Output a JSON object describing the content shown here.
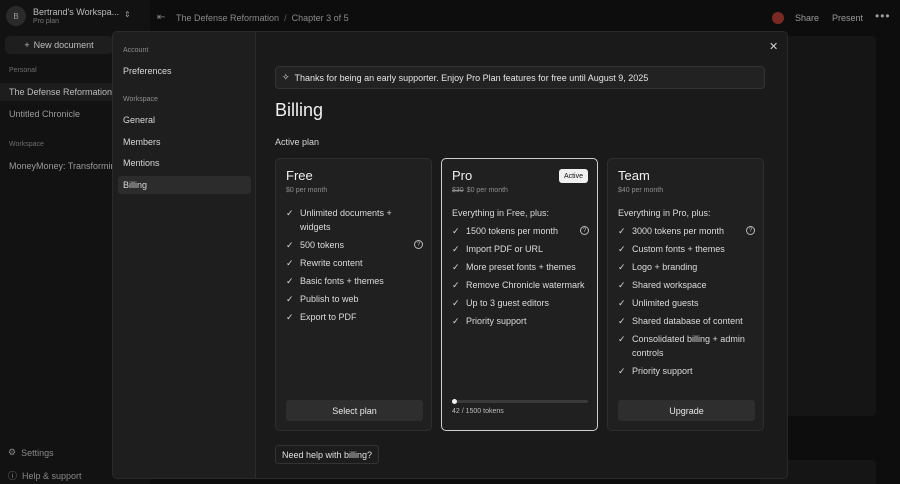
{
  "workspace": {
    "initial": "B",
    "name": "Bertrand's Workspa...",
    "plan": "Pro plan"
  },
  "sidebar": {
    "new_document": "New document",
    "personal_label": "Personal",
    "personal_items": [
      "The Defense Reformation",
      "Untitled Chronicle"
    ],
    "workspace_label": "Workspace",
    "workspace_items": [
      "MoneyMoney: Transforming"
    ],
    "settings": "Settings",
    "help": "Help & support"
  },
  "topbar": {
    "breadcrumb": [
      "The Defense Reformation",
      "Chapter 3 of 5"
    ],
    "separator": "/",
    "share": "Share",
    "present": "Present"
  },
  "modal": {
    "nav": {
      "account_label": "Account",
      "account_items": [
        "Preferences"
      ],
      "workspace_label": "Workspace",
      "workspace_items": [
        "General",
        "Members",
        "Mentions",
        "Billing"
      ],
      "active": "Billing"
    },
    "banner": "Thanks for being an early supporter. Enjoy Pro Plan features for free until August 9, 2025",
    "title": "Billing",
    "active_plan_label": "Active plan",
    "plans": [
      {
        "name": "Free",
        "price": "$0 per month",
        "old_price": "",
        "intro": "",
        "features": [
          {
            "text": "Unlimited documents + widgets",
            "help": false
          },
          {
            "text": "500 tokens",
            "help": true
          },
          {
            "text": "Rewrite content",
            "help": false
          },
          {
            "text": "Basic fonts + themes",
            "help": false
          },
          {
            "text": "Publish to web",
            "help": false
          },
          {
            "text": "Export to PDF",
            "help": false
          }
        ],
        "button": "Select plan"
      },
      {
        "name": "Pro",
        "price": "$0 per month",
        "old_price": "$30",
        "badge": "Active",
        "intro": "Everything in Free, plus:",
        "features": [
          {
            "text": "1500 tokens per month",
            "help": true
          },
          {
            "text": "Import PDF or URL",
            "help": false
          },
          {
            "text": "More preset fonts + themes",
            "help": false
          },
          {
            "text": "Remove Chronicle watermark",
            "help": false
          },
          {
            "text": "Up to 3 guest editors",
            "help": false
          },
          {
            "text": "Priority support",
            "help": false
          }
        ],
        "usage": {
          "used": 42,
          "total": 1500,
          "label": "42 / 1500 tokens"
        }
      },
      {
        "name": "Team",
        "price": "$40 per month",
        "old_price": "",
        "intro": "Everything in Pro, plus:",
        "features": [
          {
            "text": "3000 tokens per month",
            "help": true
          },
          {
            "text": "Custom fonts + themes",
            "help": false
          },
          {
            "text": "Logo + branding",
            "help": false
          },
          {
            "text": "Shared workspace",
            "help": false
          },
          {
            "text": "Unlimited guests",
            "help": false
          },
          {
            "text": "Shared database of content",
            "help": false
          },
          {
            "text": "Consolidated billing + admin controls",
            "help": false
          },
          {
            "text": "Priority support",
            "help": false
          }
        ],
        "button": "Upgrade"
      }
    ],
    "help_billing": "Need help with billing?"
  }
}
